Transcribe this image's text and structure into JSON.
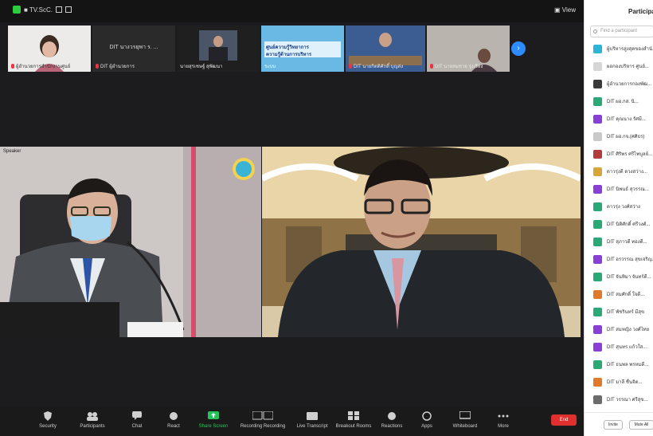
{
  "window": {
    "title": "■ TV.ScC.",
    "view_label": "▣ View"
  },
  "thumbnails": [
    {
      "name": "ผู้อำนวยการสำนักงานศูนย์"
    },
    {
      "name": "DIT ผู้อำนวยการ",
      "center_text": "DIT นางวรยุพา ร. ..."
    },
    {
      "name": "นายสุรเชษฐ์ สุพัฒนา"
    },
    {
      "name": "ระบบ",
      "slide_line1": "ศูนย์ความรู้วิทยาการ",
      "slide_line2": "ความรู้ด้านการบริหาร"
    },
    {
      "name": "DIT นายกิตติศักดิ์ บุญส่ง"
    },
    {
      "name": "DIT นายสมชาย รุ่งเรือง"
    }
  ],
  "main_videos": [
    {
      "label": "Speaker"
    },
    {
      "label": ""
    }
  ],
  "toolbar": {
    "items": [
      {
        "label": "Security"
      },
      {
        "label": "Participants"
      },
      {
        "label": "Chat"
      },
      {
        "label": "React"
      },
      {
        "label": "Share Screen"
      },
      {
        "label": "Recording Recording"
      },
      {
        "label": "Live Transcript"
      },
      {
        "label": "Breakout Rooms"
      },
      {
        "label": "Reactions"
      },
      {
        "label": "Apps"
      },
      {
        "label": "Whiteboard"
      },
      {
        "label": "More"
      }
    ],
    "end_label": "End"
  },
  "participants": {
    "title": "Participants",
    "search_placeholder": "Find a participant",
    "list": [
      {
        "name": "ผู้บริหารสูงสุดของสำนั...",
        "color": "#2bb6d8"
      },
      {
        "name": "ผอกองบริหาร ศูนย์...",
        "color": "#d6d6d6"
      },
      {
        "name": "ผู้อำนวยการกองพัฒ...",
        "color": "#3a3a3a"
      },
      {
        "name": "DIT ผอ.กส. นิ...",
        "color": "#2aa876"
      },
      {
        "name": "DIT คุณนาง รัศมี...",
        "color": "#8a3fd6"
      },
      {
        "name": "DIT ผอ.กจ.(ศศิธร)",
        "color": "#c9c9c9"
      },
      {
        "name": "DIT ศิริพร ศรีไพบูลย์...",
        "color": "#b23b3b"
      },
      {
        "name": "ดาวรุ่งดี ดวงสว่าง...",
        "color": "#d8a53a"
      },
      {
        "name": "DIT นิพนธ์ สุวรรณ...",
        "color": "#8a3fd6"
      },
      {
        "name": "ดาวรุ่ง วงศ์สว่าง",
        "color": "#2aa876"
      },
      {
        "name": "DIT นิติศักดิ์ ศรีวงศ์...",
        "color": "#2aa876"
      },
      {
        "name": "DIT สุภาวดี ทองดี...",
        "color": "#2aa876"
      },
      {
        "name": "DIT อรวรรณ สุขเจริญ...",
        "color": "#8a3fd6"
      },
      {
        "name": "DIT จันทิมา จันทร์ดี...",
        "color": "#2aa876"
      },
      {
        "name": "DIT สมศักดิ์ ใจดี...",
        "color": "#e07a2a"
      },
      {
        "name": "DIT พัชรินทร์ มีสุข",
        "color": "#2aa876"
      },
      {
        "name": "DIT สมหญิง วงศ์ไทย",
        "color": "#8a3fd6"
      },
      {
        "name": "DIT สุนทร แก้วใส...",
        "color": "#8a3fd6"
      },
      {
        "name": "DIT ธนพล พรหมดี...",
        "color": "#2aa876"
      },
      {
        "name": "DIT มาลี ชื่นจิต...",
        "color": "#e07a2a"
      },
      {
        "name": "DIT วรรณา ศรีสุข...",
        "color": "#6c6c6c"
      }
    ],
    "invite_label": "Invite",
    "mute_label": "Mute All"
  }
}
